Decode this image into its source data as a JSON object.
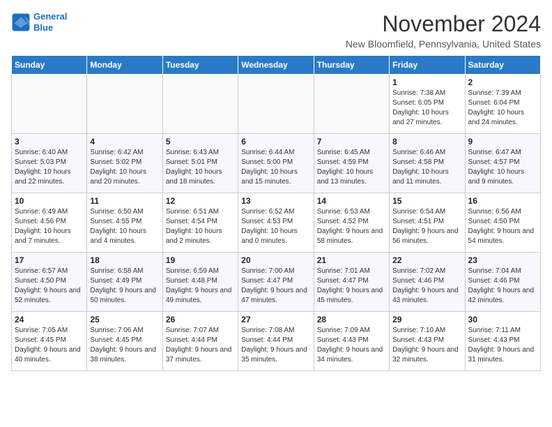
{
  "header": {
    "logo_line1": "General",
    "logo_line2": "Blue",
    "month_title": "November 2024",
    "location": "New Bloomfield, Pennsylvania, United States"
  },
  "days_of_week": [
    "Sunday",
    "Monday",
    "Tuesday",
    "Wednesday",
    "Thursday",
    "Friday",
    "Saturday"
  ],
  "weeks": [
    [
      null,
      null,
      null,
      null,
      null,
      {
        "day": "1",
        "sunrise": "7:38 AM",
        "sunset": "6:05 PM",
        "daylight": "10 hours and 27 minutes."
      },
      {
        "day": "2",
        "sunrise": "7:39 AM",
        "sunset": "6:04 PM",
        "daylight": "10 hours and 24 minutes."
      }
    ],
    [
      {
        "day": "3",
        "sunrise": "6:40 AM",
        "sunset": "5:03 PM",
        "daylight": "10 hours and 22 minutes."
      },
      {
        "day": "4",
        "sunrise": "6:42 AM",
        "sunset": "5:02 PM",
        "daylight": "10 hours and 20 minutes."
      },
      {
        "day": "5",
        "sunrise": "6:43 AM",
        "sunset": "5:01 PM",
        "daylight": "10 hours and 18 minutes."
      },
      {
        "day": "6",
        "sunrise": "6:44 AM",
        "sunset": "5:00 PM",
        "daylight": "10 hours and 15 minutes."
      },
      {
        "day": "7",
        "sunrise": "6:45 AM",
        "sunset": "4:59 PM",
        "daylight": "10 hours and 13 minutes."
      },
      {
        "day": "8",
        "sunrise": "6:46 AM",
        "sunset": "4:58 PM",
        "daylight": "10 hours and 11 minutes."
      },
      {
        "day": "9",
        "sunrise": "6:47 AM",
        "sunset": "4:57 PM",
        "daylight": "10 hours and 9 minutes."
      }
    ],
    [
      {
        "day": "10",
        "sunrise": "6:49 AM",
        "sunset": "4:56 PM",
        "daylight": "10 hours and 7 minutes."
      },
      {
        "day": "11",
        "sunrise": "6:50 AM",
        "sunset": "4:55 PM",
        "daylight": "10 hours and 4 minutes."
      },
      {
        "day": "12",
        "sunrise": "6:51 AM",
        "sunset": "4:54 PM",
        "daylight": "10 hours and 2 minutes."
      },
      {
        "day": "13",
        "sunrise": "6:52 AM",
        "sunset": "4:53 PM",
        "daylight": "10 hours and 0 minutes."
      },
      {
        "day": "14",
        "sunrise": "6:53 AM",
        "sunset": "4:52 PM",
        "daylight": "9 hours and 58 minutes."
      },
      {
        "day": "15",
        "sunrise": "6:54 AM",
        "sunset": "4:51 PM",
        "daylight": "9 hours and 56 minutes."
      },
      {
        "day": "16",
        "sunrise": "6:56 AM",
        "sunset": "4:50 PM",
        "daylight": "9 hours and 54 minutes."
      }
    ],
    [
      {
        "day": "17",
        "sunrise": "6:57 AM",
        "sunset": "4:50 PM",
        "daylight": "9 hours and 52 minutes."
      },
      {
        "day": "18",
        "sunrise": "6:58 AM",
        "sunset": "4:49 PM",
        "daylight": "9 hours and 50 minutes."
      },
      {
        "day": "19",
        "sunrise": "6:59 AM",
        "sunset": "4:48 PM",
        "daylight": "9 hours and 49 minutes."
      },
      {
        "day": "20",
        "sunrise": "7:00 AM",
        "sunset": "4:47 PM",
        "daylight": "9 hours and 47 minutes."
      },
      {
        "day": "21",
        "sunrise": "7:01 AM",
        "sunset": "4:47 PM",
        "daylight": "9 hours and 45 minutes."
      },
      {
        "day": "22",
        "sunrise": "7:02 AM",
        "sunset": "4:46 PM",
        "daylight": "9 hours and 43 minutes."
      },
      {
        "day": "23",
        "sunrise": "7:04 AM",
        "sunset": "4:46 PM",
        "daylight": "9 hours and 42 minutes."
      }
    ],
    [
      {
        "day": "24",
        "sunrise": "7:05 AM",
        "sunset": "4:45 PM",
        "daylight": "9 hours and 40 minutes."
      },
      {
        "day": "25",
        "sunrise": "7:06 AM",
        "sunset": "4:45 PM",
        "daylight": "9 hours and 38 minutes."
      },
      {
        "day": "26",
        "sunrise": "7:07 AM",
        "sunset": "4:44 PM",
        "daylight": "9 hours and 37 minutes."
      },
      {
        "day": "27",
        "sunrise": "7:08 AM",
        "sunset": "4:44 PM",
        "daylight": "9 hours and 35 minutes."
      },
      {
        "day": "28",
        "sunrise": "7:09 AM",
        "sunset": "4:43 PM",
        "daylight": "9 hours and 34 minutes."
      },
      {
        "day": "29",
        "sunrise": "7:10 AM",
        "sunset": "4:43 PM",
        "daylight": "9 hours and 32 minutes."
      },
      {
        "day": "30",
        "sunrise": "7:11 AM",
        "sunset": "4:43 PM",
        "daylight": "9 hours and 31 minutes."
      }
    ]
  ]
}
